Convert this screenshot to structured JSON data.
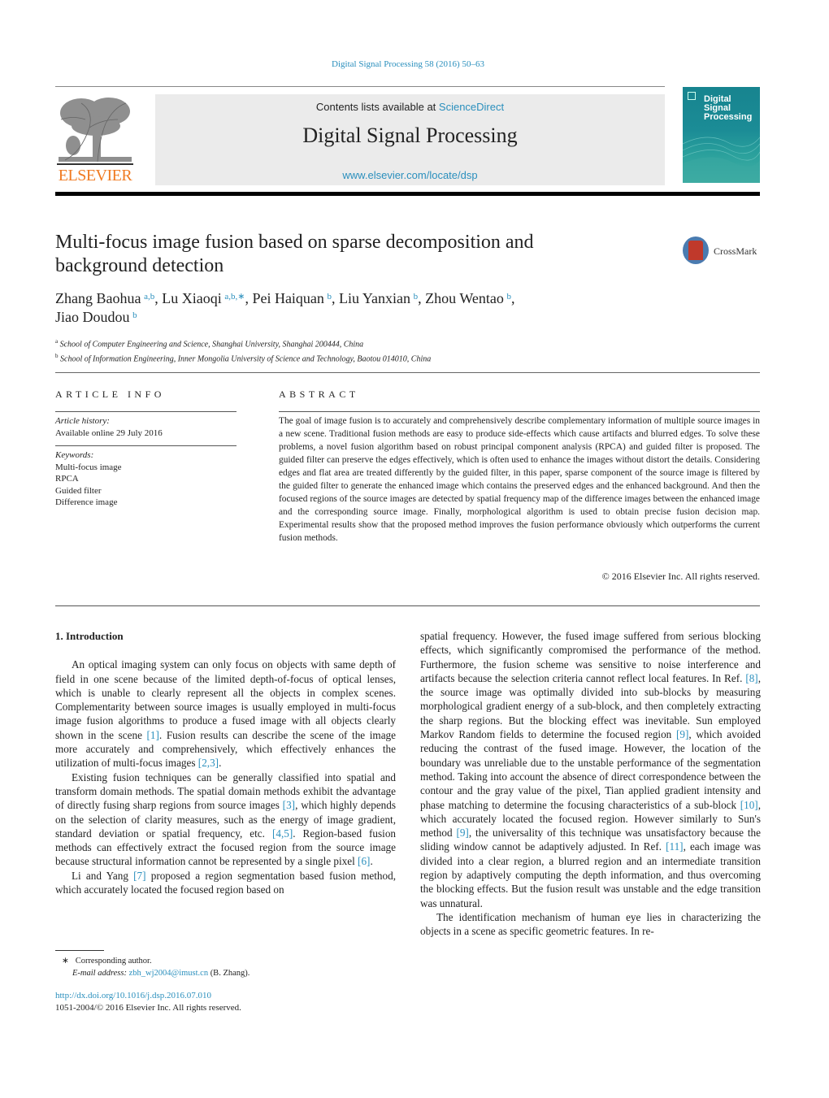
{
  "header": {
    "citation": "Digital Signal Processing 58 (2016) 50–63",
    "contents_prefix": "Contents lists available at ",
    "contents_link": "ScienceDirect",
    "journal_name": "Digital Signal Processing",
    "journal_url": "www.elsevier.com/locate/dsp",
    "publisher_logo": "ELSEVIER",
    "cover_title": [
      "Digital",
      "Signal",
      "Processing"
    ]
  },
  "article": {
    "title": "Multi-focus image fusion based on sparse decomposition and background detection",
    "crossmark_label": "CrossMark",
    "authors": [
      {
        "name": "Zhang Baohua",
        "sup": "a,b"
      },
      {
        "name": "Lu Xiaoqi",
        "sup": "a,b,∗"
      },
      {
        "name": "Pei Haiquan",
        "sup": "b"
      },
      {
        "name": "Liu Yanxian",
        "sup": "b"
      },
      {
        "name": "Zhou Wentao",
        "sup": "b"
      },
      {
        "name": "Jiao Doudou",
        "sup": "b"
      }
    ],
    "affiliations": [
      {
        "mark": "a",
        "text": "School of Computer Engineering and Science, Shanghai University, Shanghai 200444, China"
      },
      {
        "mark": "b",
        "text": "School of Information Engineering, Inner Mongolia University of Science and Technology, Baotou 014010, China"
      }
    ]
  },
  "article_info": {
    "heading": "ARTICLE INFO",
    "history_label": "Article history:",
    "history_value": "Available online 29 July 2016",
    "keywords_label": "Keywords:",
    "keywords": [
      "Multi-focus image",
      "RPCA",
      "Guided filter",
      "Difference image"
    ]
  },
  "abstract": {
    "heading": "ABSTRACT",
    "text": "The goal of image fusion is to accurately and comprehensively describe complementary information of multiple source images in a new scene. Traditional fusion methods are easy to produce side-effects which cause artifacts and blurred edges. To solve these problems, a novel fusion algorithm based on robust principal component analysis (RPCA) and guided filter is proposed. The guided filter can preserve the edges effectively, which is often used to enhance the images without distort the details. Considering edges and flat area are treated differently by the guided filter, in this paper, sparse component of the source image is filtered by the guided filter to generate the enhanced image which contains the preserved edges and the enhanced background. And then the focused regions of the source images are detected by spatial frequency map of the difference images between the enhanced image and the corresponding source image. Finally, morphological algorithm is used to obtain precise fusion decision map. Experimental results show that the proposed method improves the fusion performance obviously which outperforms the current fusion methods.",
    "copyright": "© 2016 Elsevier Inc. All rights reserved."
  },
  "body": {
    "section_heading": "1.  Introduction",
    "left_paragraphs": [
      [
        {
          "t": "An optical imaging system can only focus on objects with same depth of field in one scene because of the limited depth-of-focus of optical lenses, which is unable to clearly represent all the ob­jects in complex scenes. Complementarity between source images is usually employed in multi-focus image fusion algorithms to pro­duce a fused image with all objects clearly shown in the scene "
        },
        {
          "ref": "[1]"
        },
        {
          "t": ". Fusion results can describe the scene of the image more accurately and comprehensively, which effectively enhances the utilization of multi-focus images "
        },
        {
          "ref": "[2,3]"
        },
        {
          "t": "."
        }
      ],
      [
        {
          "t": "Existing fusion techniques can be generally classified into spa­tial and transform domain methods. The spatial domain methods exhibit the advantage of directly fusing sharp regions from source images "
        },
        {
          "ref": "[3]"
        },
        {
          "t": ", which highly depends on the selection of clarity mea­sures, such as the energy of image gradient, standard deviation or spatial frequency, etc. "
        },
        {
          "ref": "[4,5]"
        },
        {
          "t": ". Region-based fusion methods can ef­fectively extract the focused region from the source image because structural information cannot be represented by a single pixel "
        },
        {
          "ref": "[6]"
        },
        {
          "t": "."
        }
      ],
      [
        {
          "t": "Li and Yang "
        },
        {
          "ref": "[7]"
        },
        {
          "t": " proposed a region segmentation based fusion method, which accurately located the focused region based on"
        }
      ]
    ],
    "right_paragraphs": [
      [
        {
          "t": "spatial frequency. However, the fused image suffered from serious blocking effects, which significantly compromised the performance of the method. Furthermore, the fusion scheme was sensitive to noise interference and artifacts because the selection criteria can­not reflect local features. In Ref. "
        },
        {
          "ref": "[8]"
        },
        {
          "t": ", the source image was op­timally divided into sub-blocks by measuring morphological gra­dient energy of a sub-block, and then completely extracting the sharp regions. But the blocking effect was inevitable. Sun employed Markov Random fields to determine the focused region "
        },
        {
          "ref": "[9]"
        },
        {
          "t": ", which avoided reducing the contrast of the fused image. However, the location of the boundary was unreliable due to the unstable per­formance of the segmentation method. Taking into account the absence of direct correspondence between the contour and the gray value of the pixel, Tian applied gradient intensity and phase matching to determine the focusing characteristics of a sub-block "
        },
        {
          "ref": "[10]"
        },
        {
          "t": ", which accurately located the focused region. However simi­larly to Sun's method "
        },
        {
          "ref": "[9]"
        },
        {
          "t": ", the universality of this technique was unsatisfactory because the sliding window cannot be adaptively adjusted. In Ref. "
        },
        {
          "ref": "[11]"
        },
        {
          "t": ", each image was divided into a clear region, a blurred region and an intermediate transition region by adap­tively computing the depth information, and thus overcoming the blocking effects. But the fusion result was unstable and the edge transition was unnatural."
        }
      ],
      [
        {
          "t": "The identification mechanism of human eye lies in character­izing the objects in a scene as specific geometric features. In re-"
        }
      ]
    ]
  },
  "footnote": {
    "mark": "∗",
    "corresponding": "Corresponding author.",
    "email_label": "E-mail address:",
    "email": "zbh_wj2004@imust.cn",
    "email_suffix": " (B. Zhang)."
  },
  "doi": {
    "url": "http://dx.doi.org/10.1016/j.dsp.2016.07.010",
    "issn_line": "1051-2004/© 2016 Elsevier Inc. All rights reserved."
  }
}
